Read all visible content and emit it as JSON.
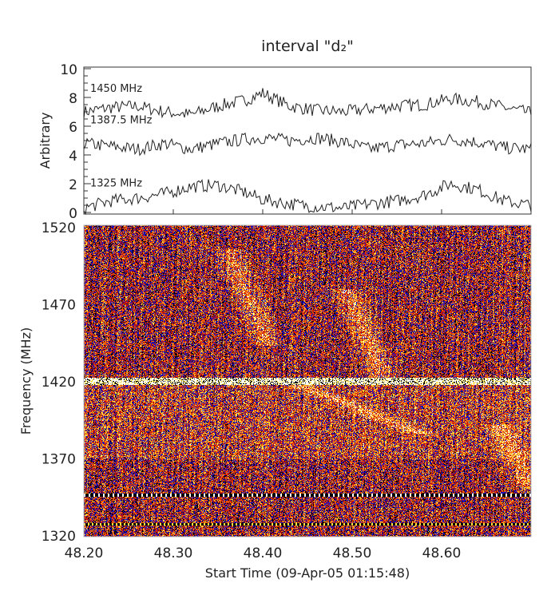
{
  "chart_data": [
    {
      "type": "line",
      "title": "interval \"d₂\"",
      "ylabel": "Arbitrary",
      "xlim": [
        48.2,
        48.7
      ],
      "ylim": [
        0,
        10
      ],
      "yticks": [
        "0",
        "2",
        "4",
        "6",
        "8",
        "10"
      ],
      "x": [
        48.2,
        48.23,
        48.26,
        48.29,
        48.32,
        48.35,
        48.38,
        48.4,
        48.43,
        48.46,
        48.49,
        48.52,
        48.55,
        48.58,
        48.61,
        48.64,
        48.67,
        48.7
      ],
      "series": [
        {
          "name": "1450 MHz",
          "values": [
            7.0,
            7.3,
            7.4,
            7.0,
            6.8,
            7.4,
            7.8,
            8.3,
            7.4,
            7.1,
            7.0,
            7.2,
            7.4,
            7.5,
            7.9,
            7.7,
            7.3,
            6.9
          ]
        },
        {
          "name": "1387.5 MHz",
          "values": [
            4.8,
            4.6,
            4.4,
            4.8,
            4.4,
            4.8,
            5.1,
            5.2,
            5.0,
            5.2,
            4.9,
            4.4,
            4.7,
            4.8,
            5.1,
            4.9,
            4.5,
            4.4
          ]
        },
        {
          "name": "1325 MHz",
          "values": [
            0.3,
            0.8,
            1.0,
            1.3,
            1.8,
            1.9,
            1.4,
            0.9,
            0.6,
            0.4,
            0.3,
            0.6,
            0.8,
            1.2,
            2.0,
            1.6,
            0.8,
            0.5
          ]
        }
      ]
    },
    {
      "type": "heatmap",
      "ylabel": "Frequency (MHz)",
      "xlabel": "Start Time (09-Apr-05 01:15:48)",
      "xlim": [
        48.2,
        48.7
      ],
      "ylim": [
        1320,
        1520
      ],
      "xticks": [
        "48.20",
        "48.30",
        "48.40",
        "48.50",
        "48.60"
      ],
      "yticks": [
        "1320",
        "1370",
        "1420",
        "1470",
        "1520"
      ],
      "colormap": [
        "#000000",
        "#1a10c0",
        "#c01010",
        "#ff6a00",
        "#ffe040",
        "#ffffff"
      ]
    }
  ]
}
